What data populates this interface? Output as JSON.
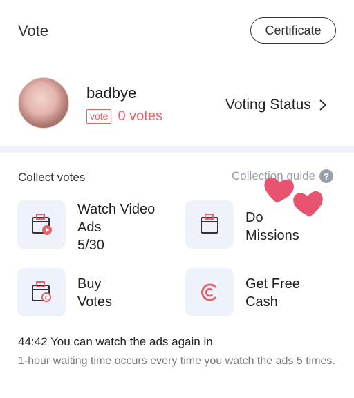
{
  "header": {
    "title": "Vote",
    "certificate_label": "Certificate"
  },
  "profile": {
    "username": "badbye",
    "vote_badge": "vote",
    "votes": "0 votes",
    "voting_status_label": "Voting Status"
  },
  "collect": {
    "title": "Collect votes",
    "guide_label": "Collection guide",
    "guide_icon": "?",
    "cards": [
      {
        "label": "Watch Video Ads",
        "sub": "5/30",
        "icon": "video-ad-icon"
      },
      {
        "label": "Do Missions",
        "sub": "",
        "icon": "missions-icon"
      },
      {
        "label": "Buy Votes",
        "sub": "",
        "icon": "buy-votes-icon"
      },
      {
        "label": "Get Free Cash",
        "sub": "",
        "icon": "free-cash-icon"
      }
    ]
  },
  "footer": {
    "timer_text": "44:42 You can watch the ads again in",
    "note": "1-hour waiting time occurs every time you watch the ads 5 times."
  },
  "colors": {
    "accent_red": "#e8616a",
    "icon_bg": "#eef3fb",
    "divider": "#eef1f6",
    "heart": "#e85370"
  }
}
